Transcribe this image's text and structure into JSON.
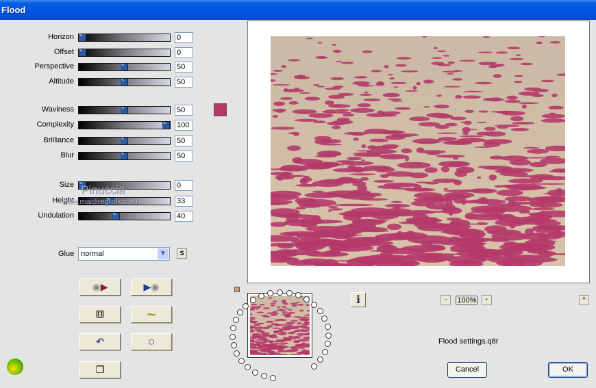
{
  "window": {
    "title": "Flood"
  },
  "sliders": [
    {
      "label": "Horizon",
      "value": "0",
      "level": 0
    },
    {
      "label": "Offset",
      "value": "0",
      "level": 0
    },
    {
      "label": "Perspective",
      "value": "50",
      "level": 50
    },
    {
      "label": "Altitude",
      "value": "50",
      "level": 50
    },
    {
      "label": "Waviness",
      "value": "50",
      "level": 50
    },
    {
      "label": "Complexity",
      "value": "100",
      "level": 100
    },
    {
      "label": "Brilliance",
      "value": "50",
      "level": 50
    },
    {
      "label": "Blur",
      "value": "50",
      "level": 50
    },
    {
      "label": "Size",
      "value": "0",
      "level": 0
    },
    {
      "label": "Height",
      "value": "33",
      "level": 33
    },
    {
      "label": "Undulation",
      "value": "40",
      "level": 40
    }
  ],
  "color": "#b43a6a",
  "glue": {
    "label": "Glue",
    "value": "normal",
    "s_label": "S"
  },
  "zoom": {
    "value": "100%",
    "minus": "−",
    "plus": "+"
  },
  "collapse_label": "^",
  "info_label": "i",
  "settings_file": "Flood settings.q8r",
  "buttons": {
    "cancel": "Cancel",
    "ok": "OK"
  },
  "watermark": {
    "line1": "Pinuccia",
    "line2": "www.maidiregrafico.eu"
  }
}
